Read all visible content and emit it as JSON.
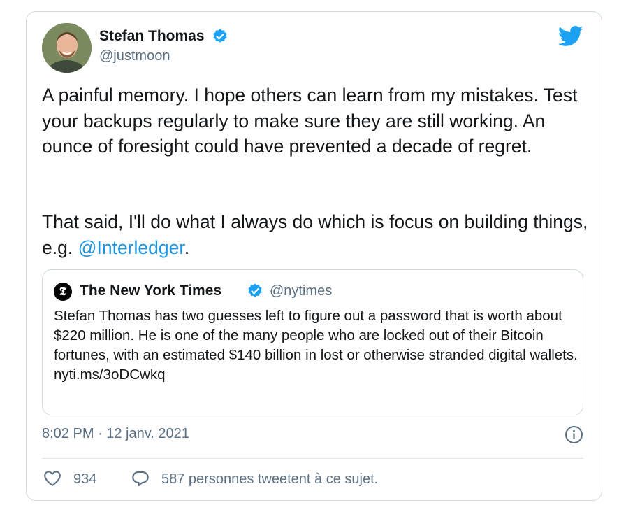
{
  "tweet": {
    "author": {
      "display_name": "Stefan Thomas",
      "handle": "@justmoon",
      "verified": true,
      "avatar_icon": "user-avatar-photo"
    },
    "text_paragraph_1": "A painful memory. I hope others can learn from my mistakes. Test your backups regularly to make sure they are still working. An ounce of foresight could have prevented a decade of regret.",
    "text_paragraph_2_prefix": "That said, I'll do what I always do which is focus on building things, e.g. ",
    "mention": "@Interledger",
    "text_paragraph_2_suffix": ".",
    "timestamp": "8:02 PM · 12 janv. 2021",
    "likes": "934",
    "replies_text": "587 personnes tweetent à ce sujet."
  },
  "quoted": {
    "logo_glyph": "𝕿",
    "display_name": "The New York Times",
    "handle": "@nytimes",
    "verified": true,
    "text": "Stefan Thomas has two guesses left to figure out a password that is worth about $220 million. He is one of the many people who are locked out of their Bitcoin fortunes, with an estimated $140 billion in lost or otherwise stranded digital wallets.",
    "link": "nyti.ms/3oDCwkq"
  },
  "colors": {
    "accent": "#1da1f2",
    "mention": "#1b95e0",
    "secondary_text": "#5b7083",
    "border": "#cfd9de"
  },
  "icons": {
    "brand": "twitter-bird-icon",
    "verified": "verified-badge-icon",
    "info": "info-icon",
    "like": "heart-icon",
    "reply": "speech-bubble-icon"
  }
}
